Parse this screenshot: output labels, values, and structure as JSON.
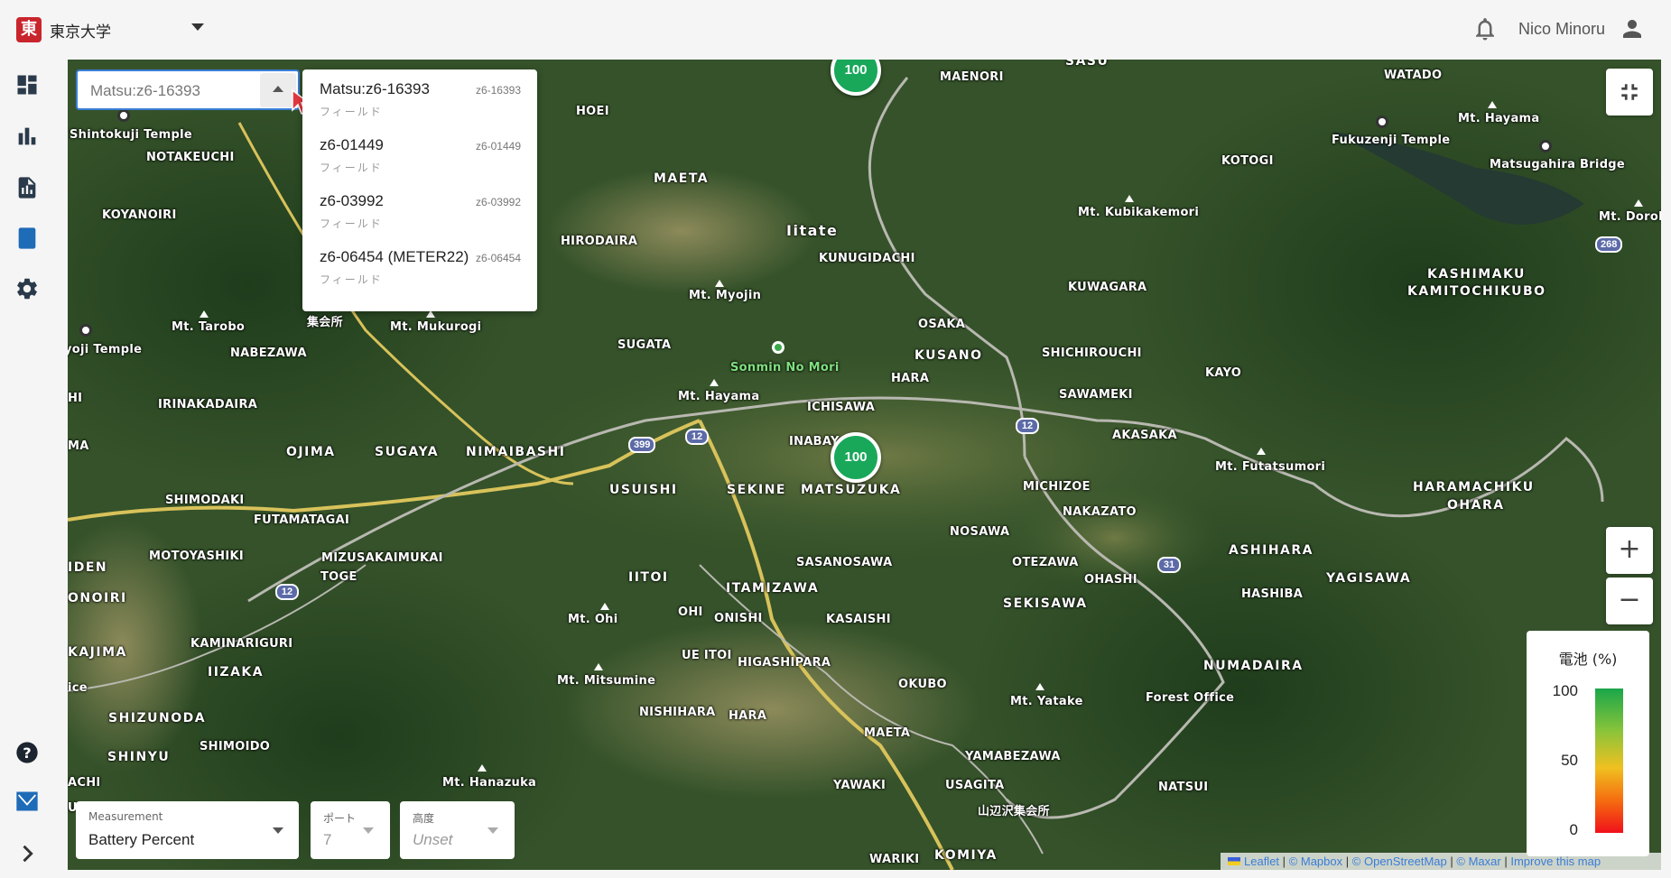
{
  "header": {
    "logo_char": "東",
    "org_name": "東京大学",
    "user_name": "Nico Minoru"
  },
  "sidebar": {
    "items": [
      {
        "name": "dashboard",
        "icon": "dashboard-icon"
      },
      {
        "name": "charts",
        "icon": "bar-chart-icon"
      },
      {
        "name": "reports",
        "icon": "report-icon"
      },
      {
        "name": "notebook",
        "icon": "notebook-icon"
      },
      {
        "name": "settings",
        "icon": "gear-icon"
      }
    ],
    "bottom": [
      {
        "name": "help",
        "icon": "help-icon"
      },
      {
        "name": "brand",
        "icon": "brand-logo-icon"
      },
      {
        "name": "expand",
        "icon": "chevron-right-icon"
      }
    ]
  },
  "search": {
    "value": "Matsu:z6-16393"
  },
  "dropdown": {
    "options": [
      {
        "name": "Matsu:z6-16393",
        "code": "z6-16393",
        "sub": "フィールド"
      },
      {
        "name": "z6-01449",
        "code": "z6-01449",
        "sub": "フィールド"
      },
      {
        "name": "z6-03992",
        "code": "z6-03992",
        "sub": "フィールド"
      },
      {
        "name": "z6-06454 (METER22)",
        "code": "z6-06454",
        "sub": "フィールド"
      }
    ]
  },
  "markers": [
    {
      "label": "100"
    },
    {
      "label": "100"
    }
  ],
  "legend": {
    "title": "電池 (%)",
    "ticks": [
      "100",
      "50",
      "0"
    ],
    "colors": [
      "#1aa64a",
      "#f0c020",
      "#f0101a"
    ]
  },
  "controls": {
    "measurement": {
      "label": "Measurement",
      "value": "Battery Percent"
    },
    "port": {
      "label": "ポート",
      "value": "7"
    },
    "height": {
      "label": "高度",
      "value": "Unset"
    }
  },
  "map_buttons": {
    "zoom_in": "+",
    "zoom_out": "−"
  },
  "attribution": {
    "leaflet": "Leaflet",
    "mapbox": "© Mapbox",
    "osm": "© OpenStreetMap",
    "maxar": "© Maxar",
    "improve": "Improve this map"
  },
  "map_labels": {
    "sasu": "SASU",
    "maenori": "MAENORI",
    "watado": "WATADO",
    "mt_hayama_ne": "Mt. Hayama",
    "fukuzenji": "Fukuzenji Temple",
    "matsugahira": "Matsugahira Bridge",
    "hoei": "HOEI",
    "shintokuji": "Shintokuji Temple",
    "notakeuchi": "NOTAKEUCHI",
    "maeta_n": "MAETA",
    "kotogi": "KOTOGI",
    "mt_kubikakemori": "Mt. Kubikakemori",
    "mt_doroku": "Mt. Doroku",
    "koyanoiri": "KOYANOIRI",
    "hirodaira": "HIRODAIRA",
    "iitate": "Iitate",
    "kunugidachi": "KUNUGIDACHI",
    "kashimaku": "KASHIMAKU",
    "kamitochikubo": "KAMITOCHIKUBO",
    "kuwagara": "KUWAGARA",
    "mt_myojin": "Mt. Myojin",
    "mt_tarobo": "Mt. Tarobo",
    "shukaisho": "集会所",
    "mt_mukurogi": "Mt. Mukurogi",
    "osaka": "OSAKA",
    "sugata": "SUGATA",
    "yoji_temple": "yoji Temple",
    "nabezawa": "NABEZAWA",
    "sonmin": "Sonmin No Mori",
    "kusano": "KUSANO",
    "shichirouchi": "SHICHIROUCHI",
    "kayo": "KAYO",
    "hara_n": "HARA",
    "mt_hayama_c": "Mt. Hayama",
    "sawameki": "SAWAMEKI",
    "irinakadaira": "IRINAKADAIRA",
    "ichisawa": "ICHISAWA",
    "akasaka": "AKASAKA",
    "inabay": "INABAY",
    "ma": "MA",
    "ojima": "OJIMA",
    "sugaya": "SUGAYA",
    "nimaibashi": "NIMAIBASHI",
    "mt_futatsumori": "Mt. Futatsumori",
    "usuishi": "USUISHI",
    "sekine": "SEKINE",
    "matsuzuka": "MATSUZUKA",
    "michizoe": "MICHIZOE",
    "haramachiku": "HARAMACHIKU",
    "ohara": "OHARA",
    "shimodaki": "SHIMODAKI",
    "nakazato": "NAKAZATO",
    "futamatagai": "FUTAMATAGAI",
    "nosawa": "NOSAWA",
    "motoyashiki": "MOTOYASHIKI",
    "mizusakaimukai": "MIZUSAKAIMUKAI",
    "sasanosawa": "SASANOSAWA",
    "otezawa": "OTEZAWA",
    "ashihara": "ASHIHARA",
    "iden": "IDEN",
    "iitoi": "IITOI",
    "ohashi": "OHASHI",
    "yagisawa": "YAGISAWA",
    "itamizawa": "ITAMIZAWA",
    "hashiba": "HASHIBA",
    "onoiri": "ONOIRI",
    "toge": "TOGE",
    "ohi": "OHI",
    "onishi": "ONISHI",
    "kasaishi": "KASAISHI",
    "sekisawa": "SEKISAWA",
    "mt_ohi": "Mt. Ohi",
    "kajima": "KAJIMA",
    "kaminariguri": "KAMINARIGURI",
    "ue_itoi": "UE ITOI",
    "numadaira": "NUMADAIRA",
    "iizaka": "IIZAKA",
    "higashipara": "HIGASHIPARA",
    "mt_mitsumine": "Mt. Mitsumine",
    "okubo": "OKUBO",
    "ice": "ice",
    "mt_yatake": "Mt. Yatake",
    "forest_office": "Forest Office",
    "shizunoda": "SHIZUNODA",
    "nishihara": "NISHIHARA",
    "hara_s": "HARA",
    "maeta_s": "MAETA",
    "shimoido": "SHIMOIDO",
    "shinyu": "SHINYU",
    "yamabezawa": "YAMABEZAWA",
    "achi": "ACHI",
    "mt_hanazuka": "Mt. Hanazuka",
    "yawaki": "YAWAKI",
    "usagita": "USAGITA",
    "yamabezawa_hall": "山辺沢集会所",
    "natsui": "NATSUI",
    "u": "U",
    "wariki": "WARIKI",
    "komiya": "KOMIYA",
    "hi": "HI"
  },
  "route_shields": [
    "399",
    "12",
    "12",
    "12",
    "268",
    "31"
  ]
}
